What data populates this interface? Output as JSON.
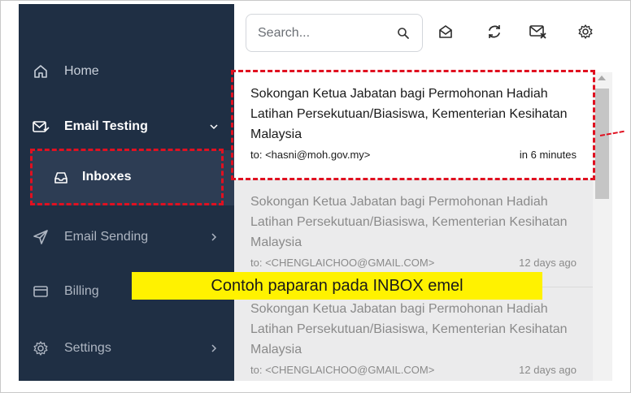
{
  "sidebar": {
    "items": [
      {
        "label": "Home",
        "icon": "home-icon"
      },
      {
        "label": "Email Testing",
        "icon": "email-testing-icon",
        "expanded": true
      },
      {
        "label": "Inboxes",
        "icon": "inbox-icon",
        "active": true
      },
      {
        "label": "Email Sending",
        "icon": "send-icon"
      },
      {
        "label": "Billing",
        "icon": "billing-icon"
      },
      {
        "label": "Settings",
        "icon": "gear-icon"
      }
    ]
  },
  "toolbar": {
    "search_placeholder": "Search...",
    "icons": [
      "search-icon",
      "mark-read-icon",
      "refresh-icon",
      "clear-inbox-icon",
      "settings-icon"
    ]
  },
  "messages": [
    {
      "subject": "Sokongan Ketua Jabatan bagi Permohonan Hadiah Latihan Persekutuan/Biasiswa, Kementerian Kesihatan Malaysia",
      "to": "to: <hasni@moh.gov.my>",
      "time": "in 6 minutes"
    },
    {
      "subject": "Sokongan Ketua Jabatan bagi Permohonan Hadiah Latihan Persekutuan/Biasiswa, Kementerian Kesihatan Malaysia",
      "to": "to: <CHENGLAICHOO@GMAIL.COM>",
      "time": "12 days ago"
    },
    {
      "subject": "Sokongan Ketua Jabatan bagi Permohonan Hadiah Latihan Persekutuan/Biasiswa, Kementerian Kesihatan Malaysia",
      "to": "to: <CHENGLAICHOO@GMAIL.COM>",
      "time": "12 days ago"
    }
  ],
  "annotation": {
    "caption": "Contoh paparan pada INBOX emel",
    "highlight_color": "#e01020",
    "banner_color": "#fff200"
  },
  "colors": {
    "sidebar_bg": "#1f2f44",
    "active_bg": "#2d3d54",
    "list_bg": "#ebebec"
  }
}
